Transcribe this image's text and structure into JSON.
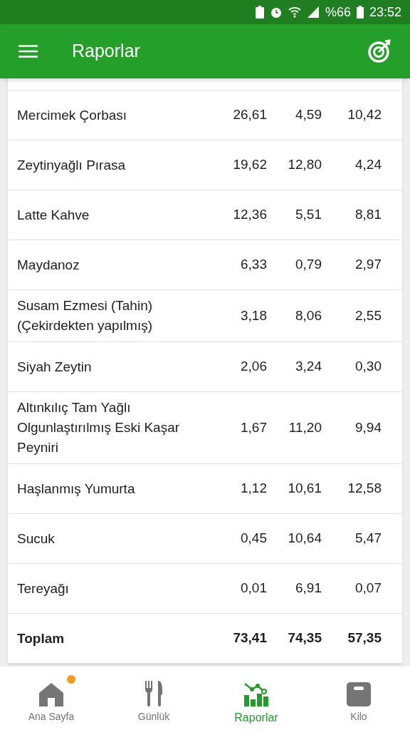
{
  "status_bar": {
    "battery_percent": "%66",
    "time": "23:52"
  },
  "app_bar": {
    "title": "Raporlar"
  },
  "table": {
    "rows": [
      {
        "name": "Mercimek Çorbası",
        "values": [
          "26,61",
          "4,59",
          "10,42"
        ]
      },
      {
        "name": "Zeytinyağlı Pırasa",
        "values": [
          "19,62",
          "12,80",
          "4,24"
        ]
      },
      {
        "name": "Latte Kahve",
        "values": [
          "12,36",
          "5,51",
          "8,81"
        ]
      },
      {
        "name": "Maydanoz",
        "values": [
          "6,33",
          "0,79",
          "2,97"
        ]
      },
      {
        "name": "Susam Ezmesi (Tahin) (Çekirdekten yapılmış)",
        "values": [
          "3,18",
          "8,06",
          "2,55"
        ]
      },
      {
        "name": "Siyah Zeytin",
        "values": [
          "2,06",
          "3,24",
          "0,30"
        ]
      },
      {
        "name": "Altınkılıç Tam Yağlı Olgunlaştırılmış Eski Kaşar Peyniri",
        "values": [
          "1,67",
          "11,20",
          "9,94"
        ]
      },
      {
        "name": "Haşlanmış Yumurta",
        "values": [
          "1,12",
          "10,61",
          "12,58"
        ]
      },
      {
        "name": "Sucuk",
        "values": [
          "0,45",
          "10,64",
          "5,47"
        ]
      },
      {
        "name": "Tereyağı",
        "values": [
          "0,01",
          "6,91",
          "0,07"
        ]
      }
    ],
    "total": {
      "name": "Toplam",
      "values": [
        "73,41",
        "74,35",
        "57,35"
      ]
    }
  },
  "bottom_nav": [
    {
      "kind": "home",
      "label": "Ana Sayfa",
      "selected": false,
      "badge": true
    },
    {
      "kind": "diary",
      "label": "Günlük",
      "selected": false,
      "badge": false
    },
    {
      "kind": "reports",
      "label": "Raporlar",
      "selected": true,
      "badge": false
    },
    {
      "kind": "weight",
      "label": "Kilo",
      "selected": false,
      "badge": false
    }
  ]
}
